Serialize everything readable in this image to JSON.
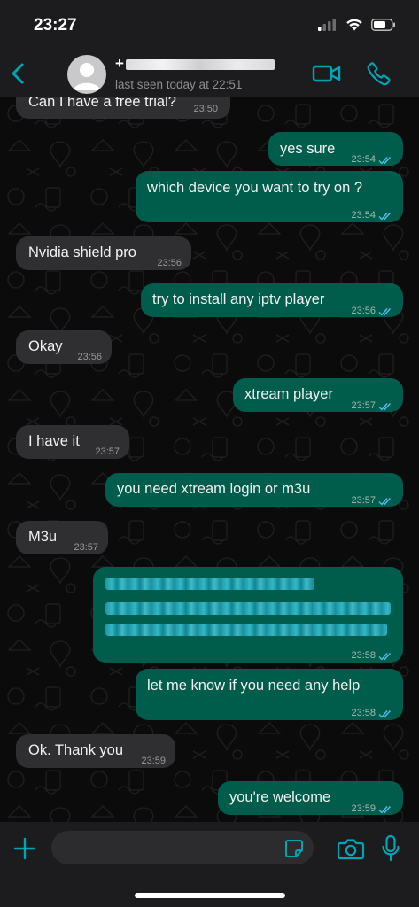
{
  "status_bar": {
    "time": "23:27"
  },
  "header": {
    "back_icon": "chevron-left-icon",
    "contact_name": "+",
    "last_seen": "last seen today at 22:51",
    "accent_color": "#00a5b5"
  },
  "messages": [
    {
      "direction": "in",
      "text": "Can I have a free trial?",
      "time": "23:50"
    },
    {
      "direction": "out",
      "text": "yes sure",
      "time": "23:54"
    },
    {
      "direction": "out",
      "text": "which device you want to try on ?",
      "time": "23:54"
    },
    {
      "direction": "in",
      "text": "Nvidia shield pro",
      "time": "23:56"
    },
    {
      "direction": "out",
      "text": "try to install any iptv player",
      "time": "23:56"
    },
    {
      "direction": "in",
      "text": "Okay",
      "time": "23:56"
    },
    {
      "direction": "out",
      "text": "xtream player",
      "time": "23:57"
    },
    {
      "direction": "in",
      "text": "I have it",
      "time": "23:57"
    },
    {
      "direction": "out",
      "text": "you need xtream login or m3u",
      "time": "23:57"
    },
    {
      "direction": "in",
      "text": "M3u",
      "time": "23:57"
    },
    {
      "direction": "out",
      "text": "",
      "redacted": true,
      "time": "23:58"
    },
    {
      "direction": "out",
      "text": "let me know if you need any help",
      "time": "23:58"
    },
    {
      "direction": "in",
      "text": "Ok. Thank you",
      "time": "23:59"
    },
    {
      "direction": "out",
      "text": "you're welcome",
      "time": "23:59"
    }
  ],
  "input_bar": {
    "placeholder": ""
  },
  "colors": {
    "incoming_bubble": "#2f2f31",
    "outgoing_bubble": "#005c4b",
    "read_ticks": "#53bdeb",
    "icon_accent": "#00a5b5"
  }
}
